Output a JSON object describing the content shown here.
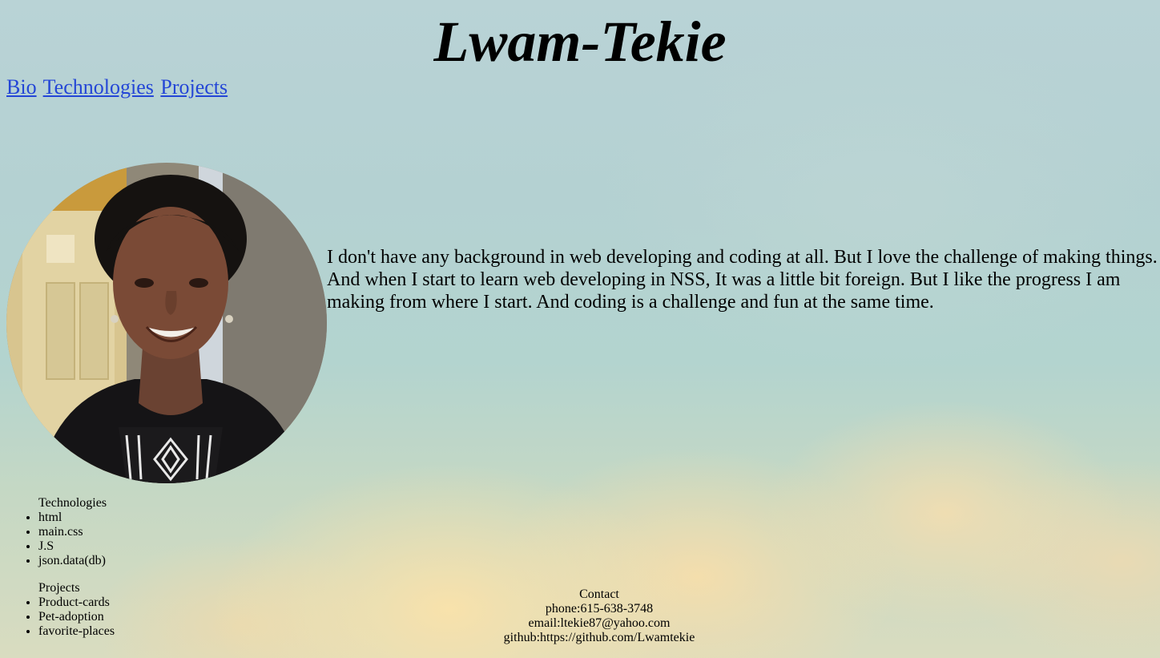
{
  "title": "Lwam-Tekie",
  "nav": {
    "bio": "Bio",
    "technologies": "Technologies",
    "projects": "Projects"
  },
  "bio": {
    "text": "I don't have any background in web developing and coding at all. But I love the challenge of making things. And when I start to learn web developing in NSS, It was a little bit foreign. But I like the progress I am making from where I start. And coding is a challenge and fun at the same time."
  },
  "technologies": {
    "heading": "Technologies",
    "items": [
      "html",
      "main.css",
      "J.S",
      "json.data(db)"
    ]
  },
  "projects": {
    "heading": "Projects",
    "items": [
      "Product-cards",
      "Pet-adoption",
      "favorite-places"
    ]
  },
  "contact": {
    "heading": "Contact",
    "phone": "phone:615-638-3748",
    "email": "email:ltekie87@yahoo.com",
    "github": "github:https://github.com/Lwamtekie"
  },
  "colors": {
    "link": "#2446d6",
    "sky": "#b4d1d2",
    "cloud": "#f8deaa"
  }
}
